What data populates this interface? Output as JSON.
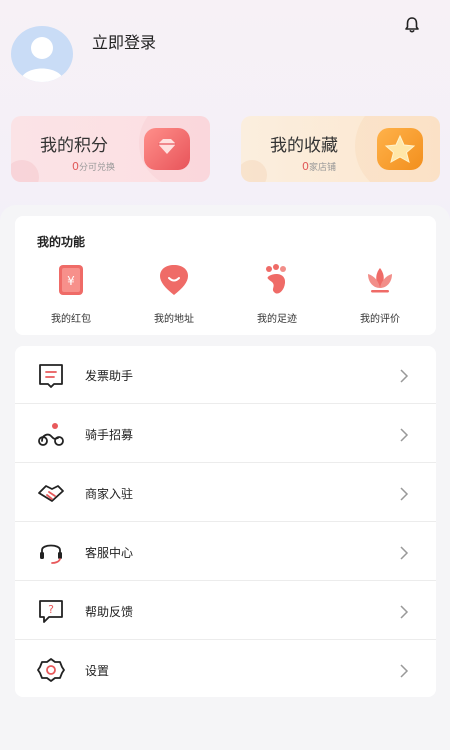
{
  "header": {
    "login_label": "立即登录",
    "bell_icon": "bell-icon"
  },
  "cards": [
    {
      "title": "我的积分",
      "count": "0",
      "suffix": "分可兑换",
      "icon": "gem-icon"
    },
    {
      "title": "我的收藏",
      "count": "0",
      "suffix": "家店铺",
      "icon": "star-icon"
    }
  ],
  "functions": {
    "title": "我的功能",
    "items": [
      {
        "label": "我的红包",
        "icon": "red-envelope-icon"
      },
      {
        "label": "我的地址",
        "icon": "address-icon"
      },
      {
        "label": "我的足迹",
        "icon": "footprint-icon"
      },
      {
        "label": "我的评价",
        "icon": "lotus-icon"
      }
    ]
  },
  "menu": [
    {
      "label": "发票助手",
      "icon": "invoice-icon"
    },
    {
      "label": "骑手招募",
      "icon": "rider-icon"
    },
    {
      "label": "商家入驻",
      "icon": "handshake-icon"
    },
    {
      "label": "客服中心",
      "icon": "headset-icon"
    },
    {
      "label": "帮助反馈",
      "icon": "help-icon"
    },
    {
      "label": "设置",
      "icon": "settings-icon"
    }
  ],
  "colors": {
    "accent": "#e8595b",
    "accent_light": "#f48a86",
    "star": "#f5a623"
  }
}
